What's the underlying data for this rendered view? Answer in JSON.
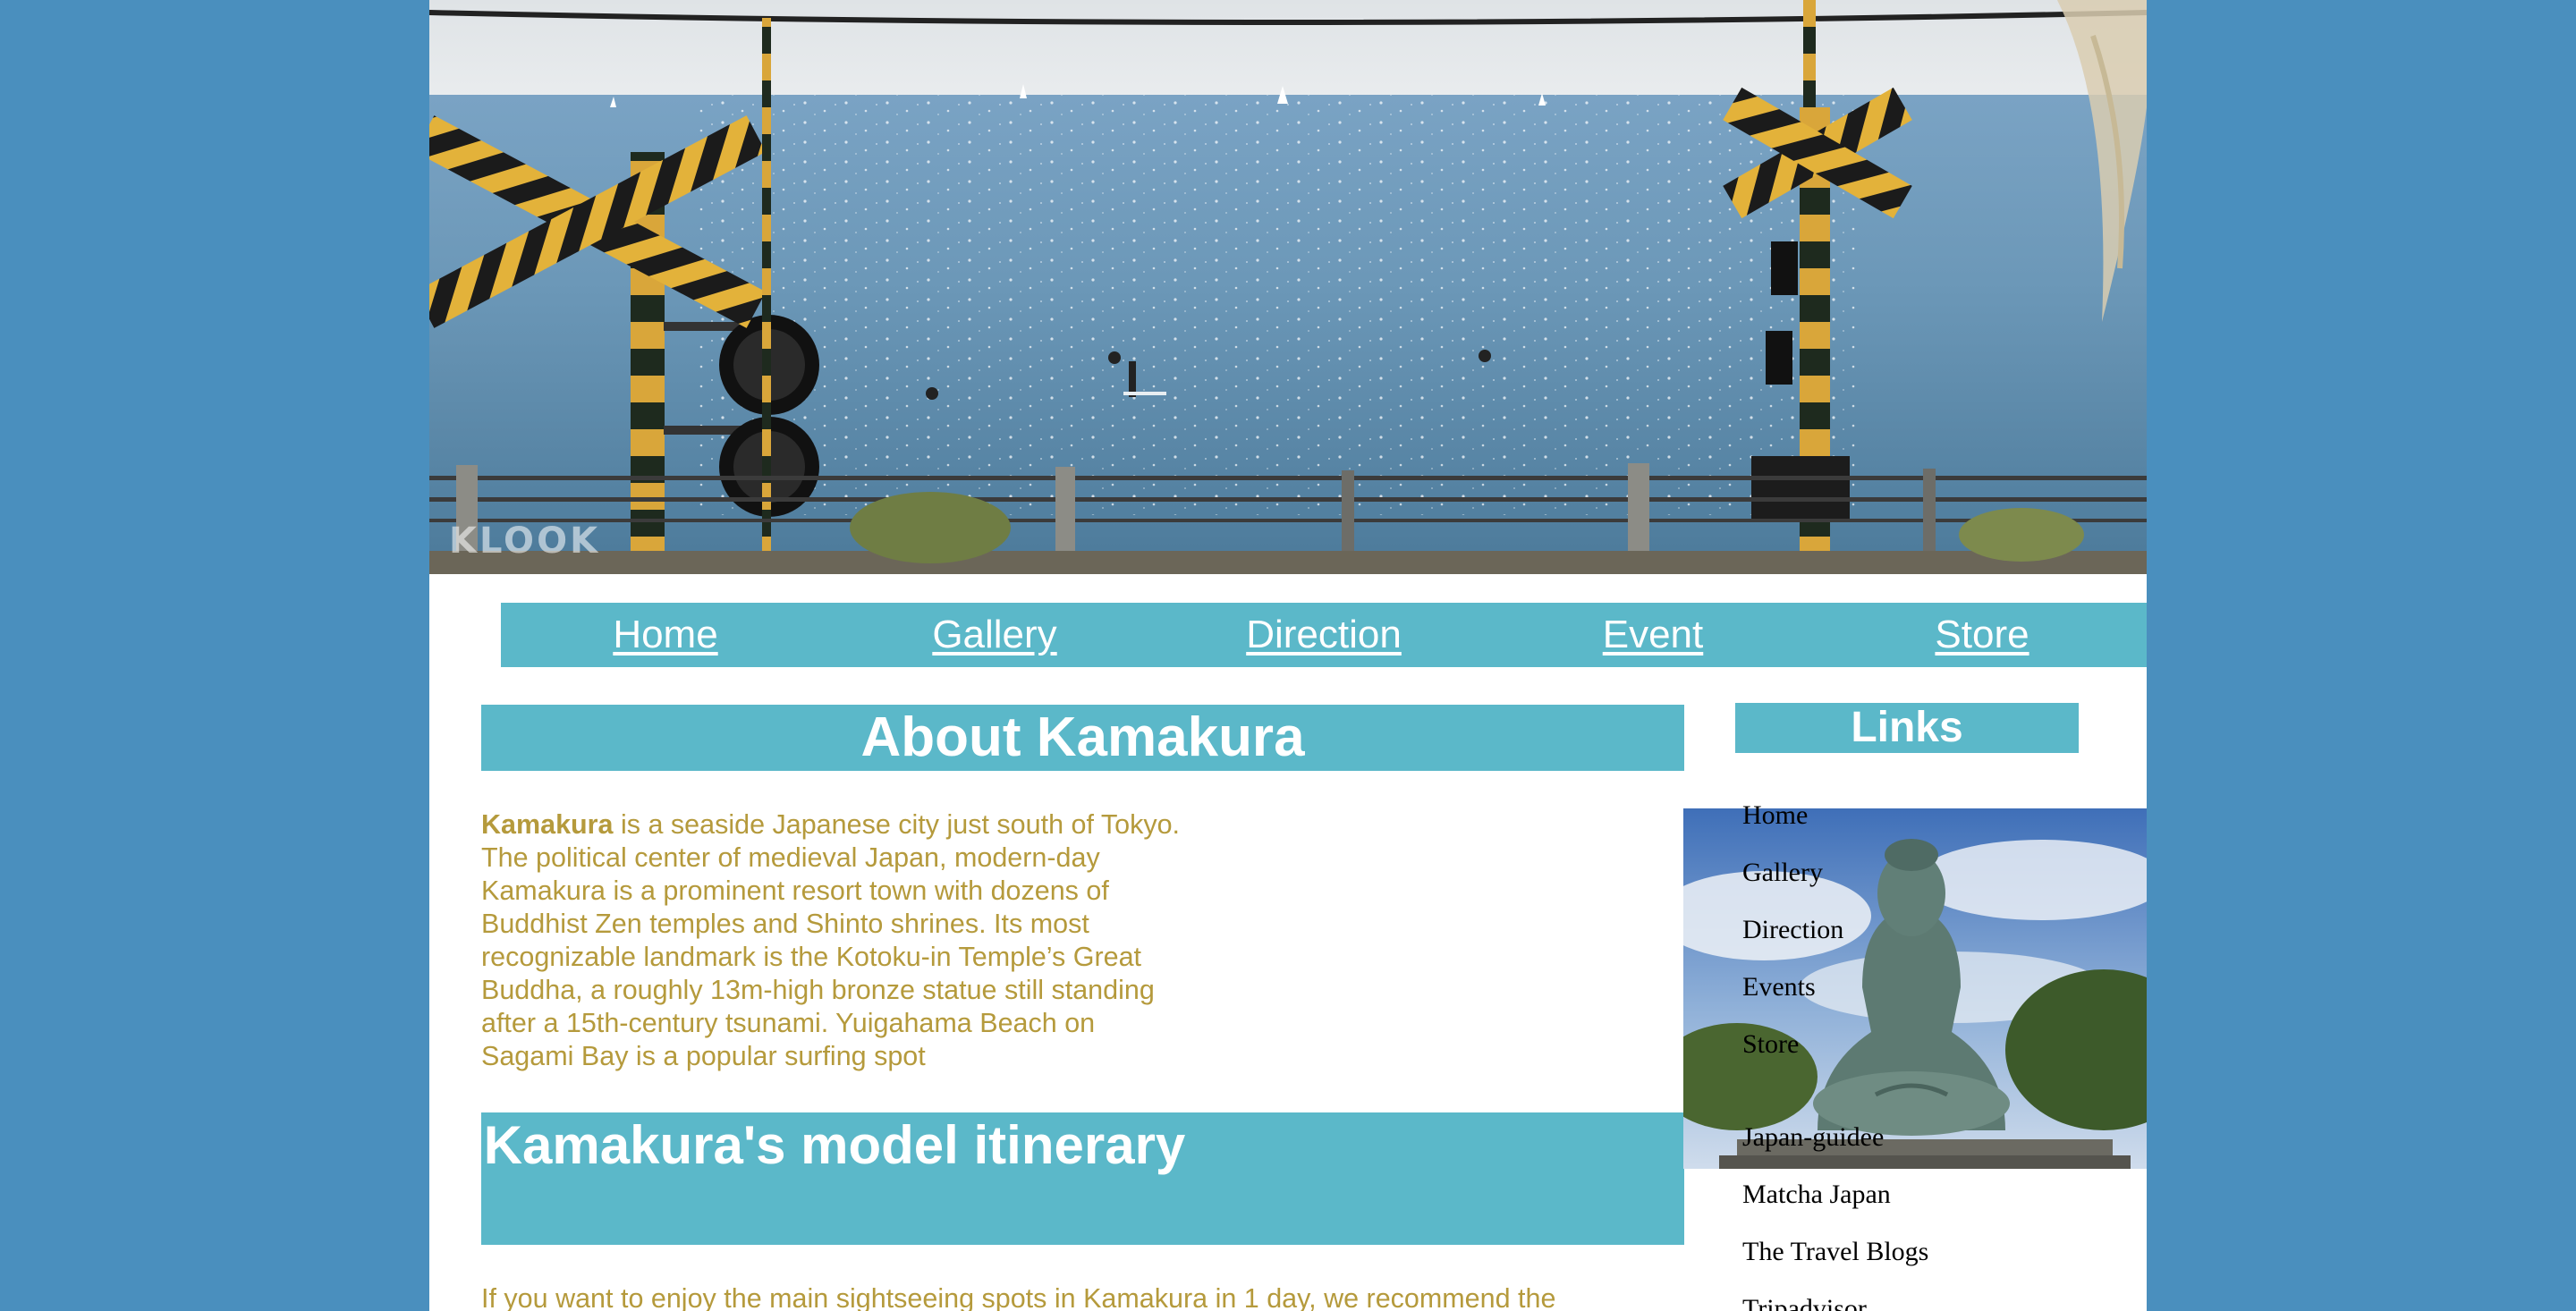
{
  "hero": {
    "watermark": "KLOOK",
    "image_alt": "Enoshima sea view behind a railway crossing"
  },
  "nav": {
    "items": [
      {
        "label": "Home"
      },
      {
        "label": "Gallery"
      },
      {
        "label": "Direction"
      },
      {
        "label": "Event"
      },
      {
        "label": "Store"
      }
    ]
  },
  "about": {
    "title": "About Kamakura",
    "intro_bold": "Kamakura",
    "intro_text": " is a seaside Japanese city just south of Tokyo. The political center of medieval Japan, modern-day Kamakura is a prominent resort town with dozens of Buddhist Zen temples and Shinto shrines. Its most recognizable landmark is the Kotoku-in Temple’s Great Buddha, a roughly 13m-high bronze statue still standing after a 15th-century tsunami. Yuigahama Beach on Sagami Bay is a popular surfing spot",
    "photo_alt": "Great Buddha of Kamakura"
  },
  "itinerary": {
    "title": "Kamakura's model itinerary",
    "text": "If you want to enjoy the main sightseeing spots in Kamakura in 1 day, we recommend the"
  },
  "sidebar": {
    "title": "Links",
    "primary_links": [
      {
        "label": "Home"
      },
      {
        "label": "Gallery"
      },
      {
        "label": "Direction"
      },
      {
        "label": "Events"
      },
      {
        "label": "Store"
      }
    ],
    "external_links": [
      {
        "label": "Japan-guidee"
      },
      {
        "label": "Matcha Japan"
      },
      {
        "label": "The Travel Blogs"
      },
      {
        "label": "Tripadvisor"
      }
    ]
  },
  "colors": {
    "background": "#4a8fbe",
    "accent_bar": "#5bb8c9",
    "body_text": "#b59a3c",
    "heading_text": "#ffffff"
  }
}
